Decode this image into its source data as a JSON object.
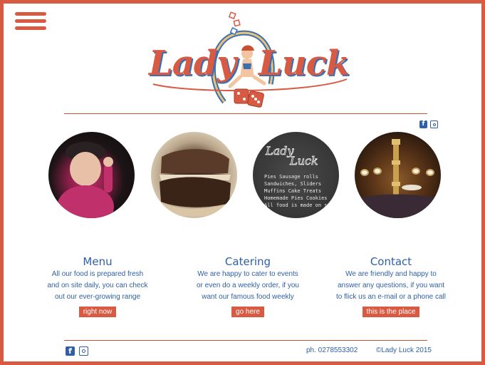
{
  "header": {
    "menu_icon": "hamburger-icon",
    "logo_text_1": "Lady",
    "logo_text_2": "Luck"
  },
  "colors": {
    "accent": "#d95a43",
    "text_blue": "#2f5fa6"
  },
  "social_top": [
    "facebook-icon",
    "instagram-icon"
  ],
  "gallery": [
    {
      "name": "child-photo"
    },
    {
      "name": "pie-photo"
    },
    {
      "name": "chalkboard-menu-photo",
      "chalk_lines": [
        "Pies Sausage rolls",
        "Sandwiches, Sliders",
        "Muffins Cake Treats",
        "Homemade Pies Cookies",
        "All food is made on site"
      ]
    },
    {
      "name": "restaurant-interior-photo"
    }
  ],
  "sections": {
    "menu": {
      "title": "Menu",
      "lines": [
        "All our food is prepared fresh",
        "and on site daily, you can check",
        "out our ever-growing range"
      ],
      "button": "right now"
    },
    "catering": {
      "title": "Catering",
      "lines": [
        "We are happy to cater to events",
        "or even do a weekly order, if you",
        "want our famous food weekly"
      ],
      "button": "go here"
    },
    "contact": {
      "title": "Contact",
      "lines": [
        "We are friendly and happy to",
        "answer any questions, if you want",
        "to flick us an e-mail or a phone call"
      ],
      "button": "this is the place"
    }
  },
  "footer": {
    "phone": "ph. 0278553302",
    "copyright": "©Lady Luck 2015"
  }
}
